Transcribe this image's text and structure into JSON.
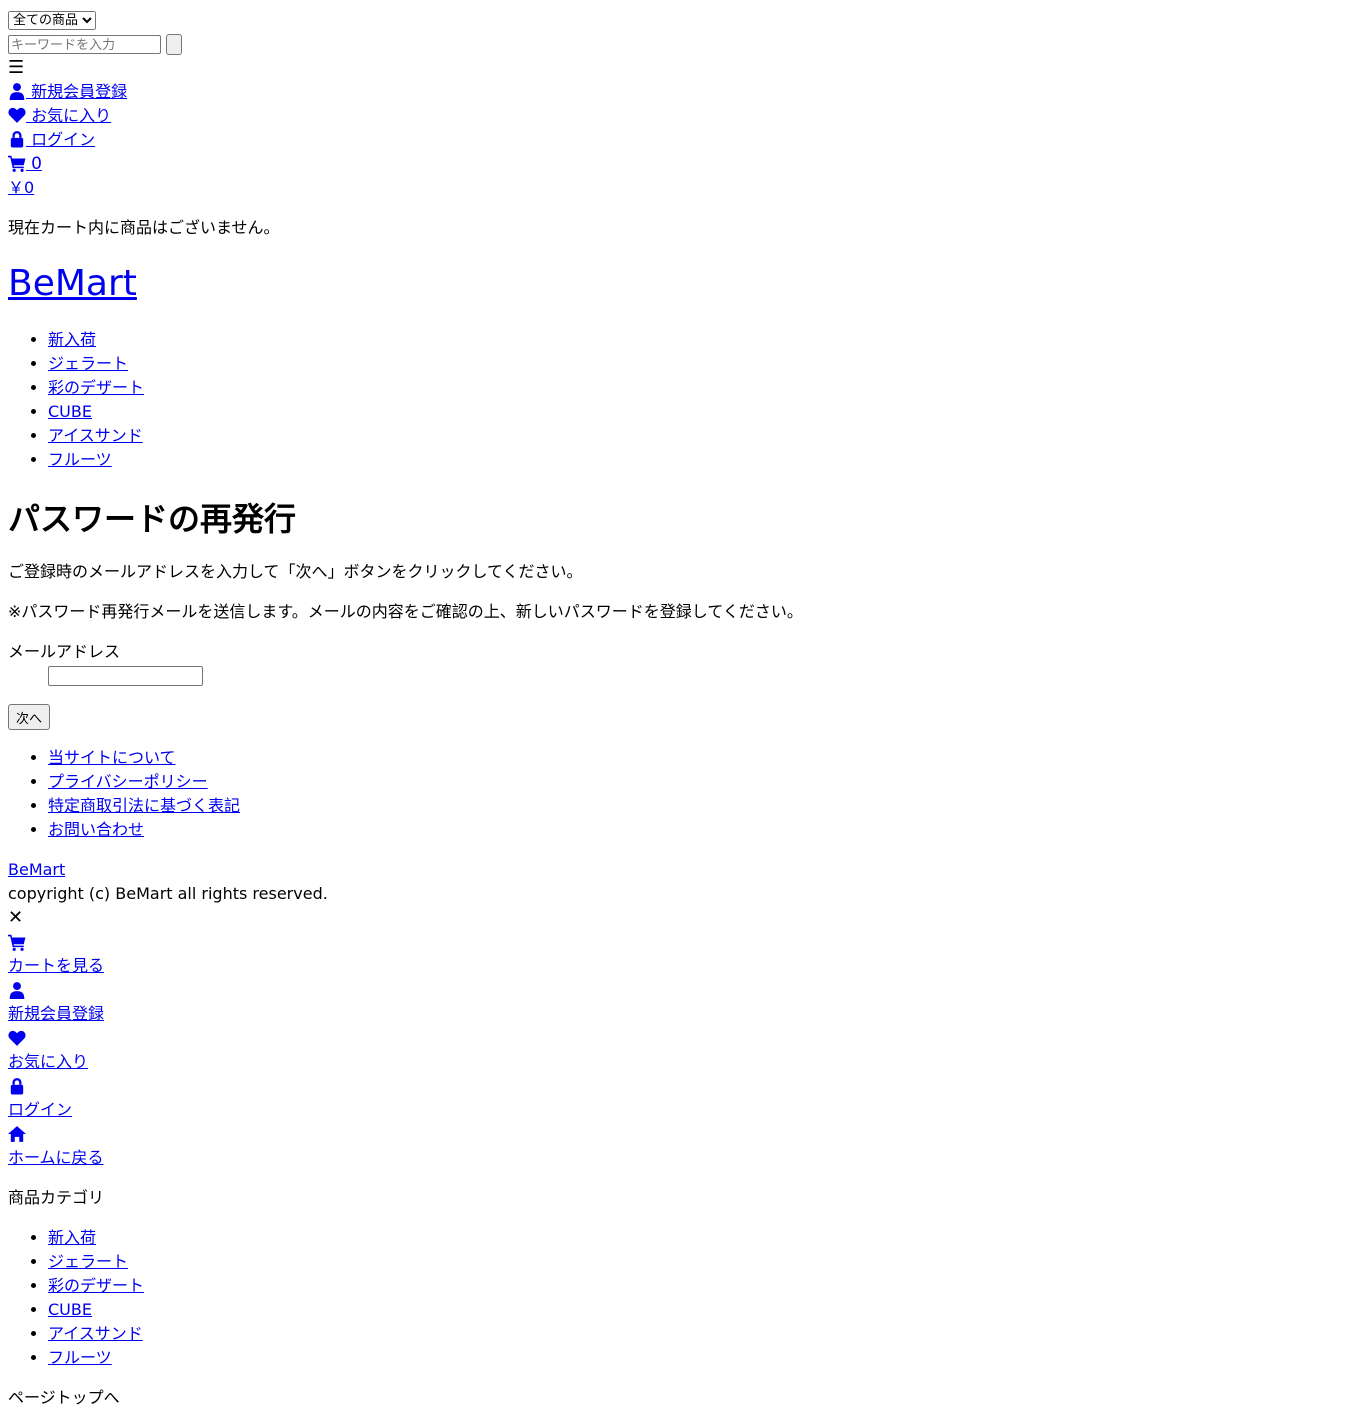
{
  "header": {
    "category_select": "全ての商品",
    "search_placeholder": "キーワードを入力",
    "menu_glyph": "☰",
    "links": {
      "signup": "新規会員登録",
      "favorites": "お気に入り",
      "login": "ログイン"
    },
    "cart_count": "0",
    "cart_total": "￥0",
    "cart_empty_message": "現在カート内に商品はございません。"
  },
  "site_title": "BeMart",
  "categories": [
    "新入荷",
    "ジェラート",
    "彩のデザート",
    "CUBE",
    "アイスサンド",
    "フルーツ"
  ],
  "page": {
    "title": "パスワードの再発行",
    "instruction": "ご登録時のメールアドレスを入力して「次へ」ボタンをクリックしてください。",
    "note": "※パスワード再発行メールを送信します。メールの内容をご確認の上、新しいパスワードを登録してください。",
    "email_label": "メールアドレス",
    "email_value": "",
    "next_button": "次へ"
  },
  "footer": {
    "links": [
      "当サイトについて",
      "プライバシーポリシー",
      "特定商取引法に基づく表記",
      "お問い合わせ"
    ],
    "brand": "BeMart",
    "copyright": "copyright (c) BeMart all rights reserved."
  },
  "drawer": {
    "close_glyph": "✕",
    "cart_link": "カートを見る",
    "signup_link": "新規会員登録",
    "favorites_link": "お気に入り",
    "login_link": "ログイン",
    "home_link": "ホームに戻る",
    "category_heading": "商品カテゴリ",
    "categories": [
      "新入荷",
      "ジェラート",
      "彩のデザート",
      "CUBE",
      "アイスサンド",
      "フルーツ"
    ]
  },
  "page_top": "ページトップへ",
  "colors": {
    "link": "#0000ee"
  }
}
